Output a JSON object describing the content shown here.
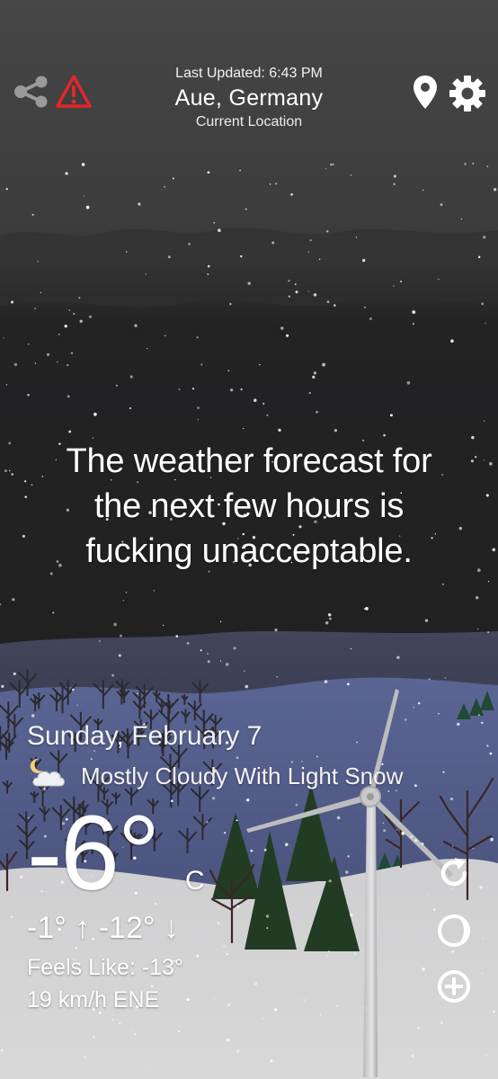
{
  "header": {
    "last_updated": "Last Updated: 6:43 PM",
    "location": "Aue, Germany",
    "location_sub": "Current Location"
  },
  "message": {
    "line1": "The weather forecast for",
    "line2": "the next few hours is",
    "line3": "fucking unacceptable."
  },
  "current": {
    "date": "Sunday, February 7",
    "condition": "Mostly Cloudy With Light Snow",
    "temperature": "-6°",
    "unit": "C",
    "high": "-1°",
    "low": "-12°",
    "hilo_text": "-1° ↑  -12° ↓",
    "feels_like": "Feels Like: -13°",
    "wind": "19 km/h ENE"
  },
  "icons": {
    "share": "share-icon",
    "alert": "warning-icon",
    "location": "location-pin-icon",
    "settings": "gear-icon",
    "refresh": "refresh-icon",
    "moon": "moon-phase-icon",
    "add": "plus-circle-icon",
    "condition": "cloud-snow-night-icon"
  },
  "colors": {
    "alert_red": "#e3262b",
    "sky_top": "#444445",
    "ground": "#d4d4d4",
    "hill_blue": "#56608a",
    "tree_green": "#223c22"
  }
}
